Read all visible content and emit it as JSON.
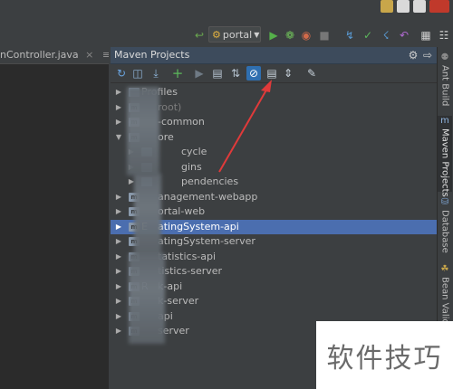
{
  "colors": {
    "background": "#2b2b2b",
    "panel": "#3c3f41",
    "selection": "#4b6eaf",
    "annotation_arrow": "#e03a3a"
  },
  "toolbar": {
    "run_config_label": "portal",
    "icons": [
      "run-icon",
      "debug-icon",
      "coverage-icon",
      "stop-icon",
      "vcs-update-icon",
      "vcs-commit-icon",
      "vcs-compare-icon",
      "vcs-revert-icon",
      "project-structure-icon",
      "settings-icon"
    ]
  },
  "editor": {
    "tab_label": "nController.java",
    "tab_menu_label": "≡₂"
  },
  "maven_panel": {
    "title": "Maven Projects",
    "header_icons": [
      "gear-icon",
      "hide-icon"
    ],
    "toolbar_icons": [
      "reimport-icon",
      "generate-sources-icon",
      "download-icon",
      "add-icon",
      "run-build-icon",
      "run-config-icon",
      "toggle-offline-icon",
      "skip-tests-icon",
      "show-dependencies-icon",
      "collapse-all-icon",
      "settings-icon"
    ],
    "tree": [
      {
        "label": "Profiles",
        "indent": 0,
        "expanded": false,
        "type": "folder"
      },
      {
        "label": "root)",
        "indent": 0,
        "expanded": false,
        "type": "module",
        "dim": true
      },
      {
        "label": "-common",
        "indent": 0,
        "expanded": false,
        "type": "module"
      },
      {
        "label": "ore",
        "indent": 0,
        "expanded": true,
        "type": "module"
      },
      {
        "label": "cycle",
        "indent": 1,
        "expanded": false,
        "type": "folder"
      },
      {
        "label": "gins",
        "indent": 1,
        "expanded": false,
        "type": "folder"
      },
      {
        "label": "pendencies",
        "indent": 1,
        "expanded": false,
        "type": "folder"
      },
      {
        "label": "anagement-webapp",
        "indent": 0,
        "expanded": false,
        "type": "module"
      },
      {
        "label": "ortal-web",
        "indent": 0,
        "expanded": false,
        "type": "module"
      },
      {
        "label": "atingSystem-api",
        "prefix": "E",
        "indent": 0,
        "expanded": false,
        "type": "module",
        "selected": true
      },
      {
        "label": "atingSystem-server",
        "indent": 0,
        "expanded": false,
        "type": "module"
      },
      {
        "label": "tatistics-api",
        "indent": 0,
        "expanded": false,
        "type": "module"
      },
      {
        "label": "tistics-server",
        "indent": 0,
        "expanded": false,
        "type": "module"
      },
      {
        "label": "k-api",
        "prefix": "R",
        "indent": 0,
        "expanded": false,
        "type": "module"
      },
      {
        "label": "k-server",
        "indent": 0,
        "expanded": false,
        "type": "module"
      },
      {
        "label": "api",
        "indent": 0,
        "expanded": false,
        "type": "module"
      },
      {
        "label": "server",
        "indent": 0,
        "expanded": false,
        "type": "module"
      }
    ]
  },
  "side_tabs": [
    {
      "label": "Ant Build",
      "icon": "ant-icon",
      "active": false
    },
    {
      "label": "Maven Projects",
      "icon": "maven-icon",
      "active": true
    },
    {
      "label": "Database",
      "icon": "database-icon",
      "active": false
    },
    {
      "label": "Bean Validati",
      "icon": "bean-icon",
      "active": false
    }
  ],
  "watermark": {
    "text": "软件技巧"
  }
}
